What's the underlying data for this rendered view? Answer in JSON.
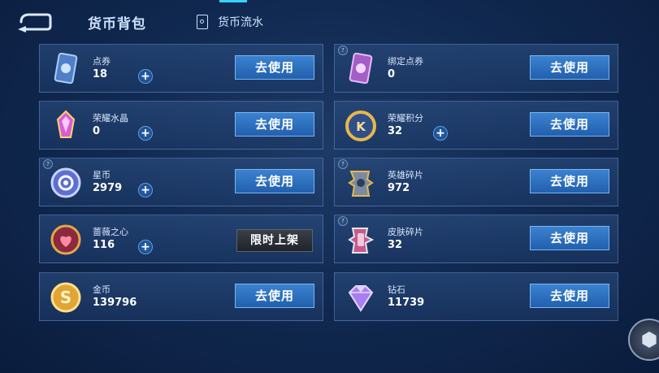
{
  "header": {
    "title": "货币背包",
    "flow_link_label": "货币流水"
  },
  "colors": {
    "accent": "#35d3ff",
    "button_blue": "#2f74c4",
    "limited_gray": "#2a2f36"
  },
  "currencies": [
    {
      "name": "点券",
      "amount": "18",
      "icon": "coupon-card-icon",
      "button": "去使用",
      "has_plus": true,
      "has_info": false
    },
    {
      "name": "绑定点券",
      "amount": "0",
      "icon": "bound-coupon-card-icon",
      "button": "去使用",
      "has_plus": false,
      "has_info": true
    },
    {
      "name": "荣耀水晶",
      "amount": "0",
      "icon": "glory-crystal-icon",
      "button": "去使用",
      "has_plus": true,
      "has_info": false
    },
    {
      "name": "荣耀积分",
      "amount": "32",
      "icon": "glory-points-icon",
      "button": "去使用",
      "has_plus": true,
      "has_info": false
    },
    {
      "name": "星币",
      "amount": "2979",
      "icon": "star-coin-icon",
      "button": "去使用",
      "has_plus": true,
      "has_info": true
    },
    {
      "name": "英雄碎片",
      "amount": "972",
      "icon": "hero-fragment-icon",
      "button": "去使用",
      "has_plus": false,
      "has_info": true
    },
    {
      "name": "蔷薇之心",
      "amount": "116",
      "icon": "rose-heart-icon",
      "button": "限时上架",
      "has_plus": true,
      "has_info": false
    },
    {
      "name": "皮肤碎片",
      "amount": "32",
      "icon": "skin-fragment-icon",
      "button": "去使用",
      "has_plus": false,
      "has_info": true
    },
    {
      "name": "金币",
      "amount": "139796",
      "icon": "gold-coin-icon",
      "button": "去使用",
      "has_plus": false,
      "has_info": false
    },
    {
      "name": "钻石",
      "amount": "11739",
      "icon": "diamond-icon",
      "button": "去使用",
      "has_plus": false,
      "has_info": false
    }
  ]
}
